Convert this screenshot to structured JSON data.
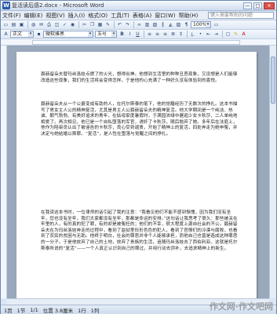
{
  "window": {
    "title": "复活读后感2.docx - Microsoft Word",
    "minimize": "—",
    "maximize": "□",
    "close": "✕"
  },
  "menu": {
    "items": [
      "文件(F)",
      "编辑(E)",
      "视图(V)",
      "插入(I)",
      "格式(O)",
      "工具(T)",
      "表格(A)",
      "窗口(W)",
      "帮助(H)"
    ],
    "help_search_placeholder": "键入需要帮助的问题"
  },
  "toolbar": {
    "style_value": "正文",
    "font_value": "微软雅黑",
    "size_value": "五号"
  },
  "document": {
    "paragraphs": [
      "聂赫留朵夫替玛丝洛娃点燃了的火光，想得出神。他想到生活里的种种丑恶现象，又设想是人们能够改造这些现象，我们的生活将会变得怎样。于是他的心充满了一种好久没有体验到的喜悦。",
      "聂赫留朵夫从一个公爵变成有助的人，在托尔斯泰的笔下，他的觉醒经历了无数次的挣扎。这本书描写了男女主人公的精神复活，尤其是男主人公聂赫留朵夫的精神复活。他大学期间是一个纯洁、热诚、朝气勃勃、有美好追求的青年，在姑母家度暑假时，于满园浓绿中邂逅少女卡秋莎，二人单纯地相爱了。再次相见，他已是一个自私堕落的军官，诱奸了卡秋莎，随后抛弃了她。多年后在法庭上，他作为陪审员认出了被诬告的卡秋莎，良心受到谴责，开始了精神上的复活，四处奔走为她申冤，并决定与她结婚以赎罪。“复活”，是人性在堕落与觉醒之间的挣扎。",
      "在我读这本书时，一位律师的话引起了我的注意：“我看见他们不能不感到惭愧，因为我们没有坐牢，您也没有坐牢，我们大家都没有坐牢，那都是命运的安排。”这句话让我思考了很久：那些被关在牢里的人，有的真的犯了罪，有的却是被冤枉的；他们的不幸，很大程度上源自社会的不公。聂赫留朵夫在为玛丝洛娃奔走的过程中，看到了监狱里形形色色的犯人，看到了官僚们的冷漠与腐败，也看到了农民的贫困与无助。他终于明白，社会的罪恶并非个人能够承担，而他自己也曾是造成这种罪恶的一分子。于是他放弃了自己的土地，放弃了贵族的生活，追随玛丝洛娃去了西伯利亚。这就是托尔斯泰所说的“复活”——一个人真正认识到自己的罪过，并用行动去弥补，去追求精神上的新生。"
    ]
  },
  "status": {
    "page": "1页",
    "section": "1节",
    "pages": "1/1",
    "position": "位置 3.8厘米",
    "line": "1行",
    "column": "1列"
  },
  "watermark": "作文网·作文吧网"
}
